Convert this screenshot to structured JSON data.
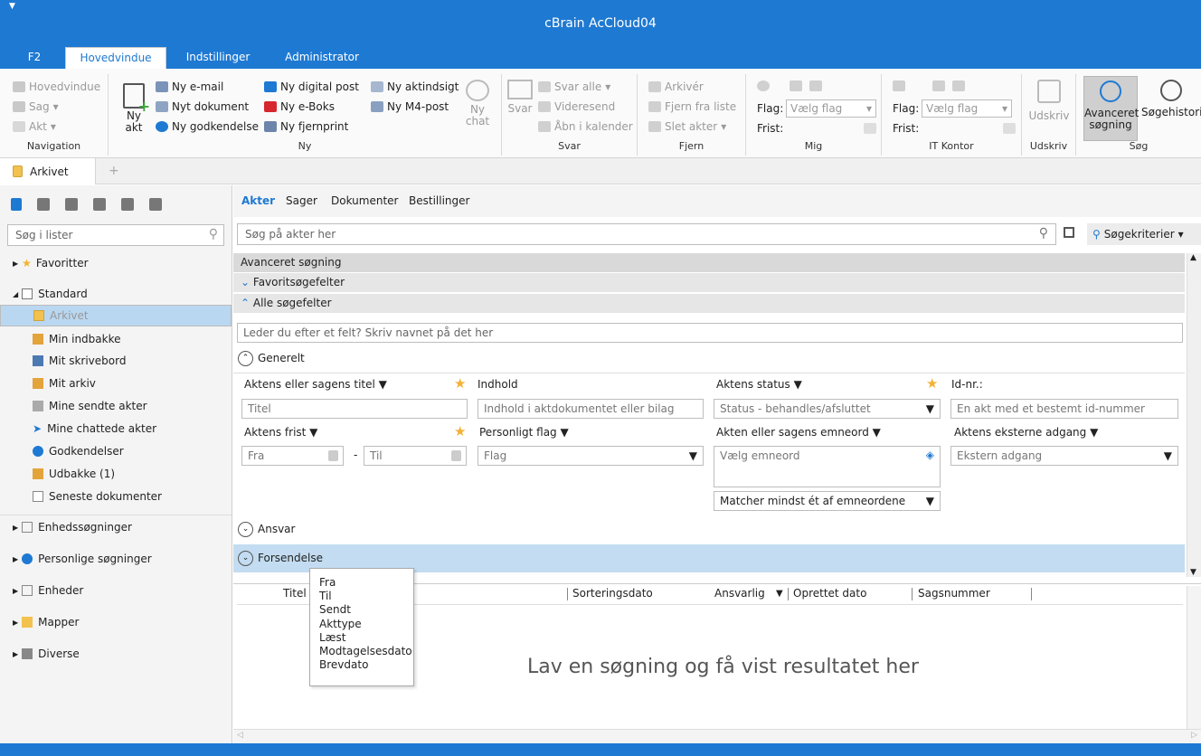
{
  "app": {
    "title": "cBrain AcCloud04"
  },
  "ribbon_tabs": [
    "F2",
    "Hovedvindue",
    "Indstillinger",
    "Administrator"
  ],
  "ribbon": {
    "navigation": {
      "label": "Navigation",
      "items": [
        "Hovedvindue",
        "Sag",
        "Akt"
      ]
    },
    "ny": {
      "label": "Ny",
      "ny_akt": "Ny akt",
      "items": [
        "Ny e-mail",
        "Nyt dokument",
        "Ny godkendelse",
        "Ny digital post",
        "Ny e-Boks",
        "Ny fjernprint",
        "Ny aktindsigt",
        "Ny M4-post"
      ],
      "ny_chat": "Ny chat"
    },
    "svar": {
      "label": "Svar",
      "svar": "Svar",
      "items": [
        "Svar alle",
        "Videresend",
        "Åbn i kalender"
      ]
    },
    "fjern": {
      "label": "Fjern",
      "items": [
        "Arkivér",
        "Fjern fra liste",
        "Slet akter"
      ]
    },
    "mig": {
      "label": "Mig",
      "flag_label": "Flag:",
      "flag_value": "Vælg flag",
      "frist_label": "Frist:"
    },
    "itkontor": {
      "label": "IT Kontor",
      "flag_label": "Flag:",
      "flag_value": "Vælg flag",
      "frist_label": "Frist:"
    },
    "udskriv": {
      "label": "Udskriv",
      "button": "Udskriv"
    },
    "sog": {
      "label": "Søg",
      "avanceret": "Avanceret søgning",
      "historik": "Søgehistorik"
    }
  },
  "doc_tab": "Arkivet",
  "sidebar": {
    "search_placeholder": "Søg i lister",
    "favoritter": "Favoritter",
    "standard": "Standard",
    "items": [
      "Arkivet",
      "Min indbakke",
      "Mit skrivebord",
      "Mit arkiv",
      "Mine sendte akter",
      "Mine chattede akter",
      "Godkendelser",
      "Udbakke (1)",
      "Seneste dokumenter"
    ],
    "groups": [
      "Enhedssøgninger",
      "Personlige søgninger",
      "Enheder",
      "Mapper",
      "Diverse"
    ]
  },
  "main": {
    "tabs": [
      "Akter",
      "Sager",
      "Dokumenter",
      "Bestillinger"
    ],
    "search_placeholder": "Søg på akter her",
    "sogekriterier": "Søgekriterier",
    "avanceret": "Avanceret søgning",
    "favorit": "Favoritsøgefelter",
    "alle": "Alle søgefelter",
    "field_finder": "Leder du efter et felt? Skriv navnet på det her",
    "generelt": "Generelt",
    "labels": {
      "titel": "Aktens eller sagens titel ▼",
      "indhold": "Indhold",
      "status": "Aktens status ▼",
      "id": "Id-nr.:",
      "frist": "Aktens frist ▼",
      "pflag": "Personligt flag ▼",
      "emneord": "Akten eller sagens emneord ▼",
      "ekstern": "Aktens eksterne adgang ▼"
    },
    "values": {
      "titel": "Titel",
      "indhold": "Indhold i aktdokumentet eller bilag",
      "status": "Status - behandles/afsluttet",
      "id": "En akt med et bestemt id-nummer",
      "fra": "Fra",
      "til": "Til",
      "flag": "Flag",
      "emneord": "Vælg emneord",
      "ekstern": "Ekstern adgang",
      "matcher": "Matcher mindst ét af emneordene"
    },
    "ansvar": "Ansvar",
    "forsendelse": "Forsendelse",
    "columns": [
      "Titel",
      "Sorteringsdato",
      "Ansvarlig",
      "Oprettet dato",
      "Sagsnummer"
    ],
    "empty": "Lav en søgning og få vist resultatet her"
  },
  "menu": [
    "Fra",
    "Til",
    "Sendt",
    "Akttype",
    "Læst",
    "Modtagelsesdato",
    "Brevdato"
  ],
  "colors": {
    "accent": "#1e79d2",
    "selected": "#b9d7f1",
    "star": "#f2b134"
  }
}
